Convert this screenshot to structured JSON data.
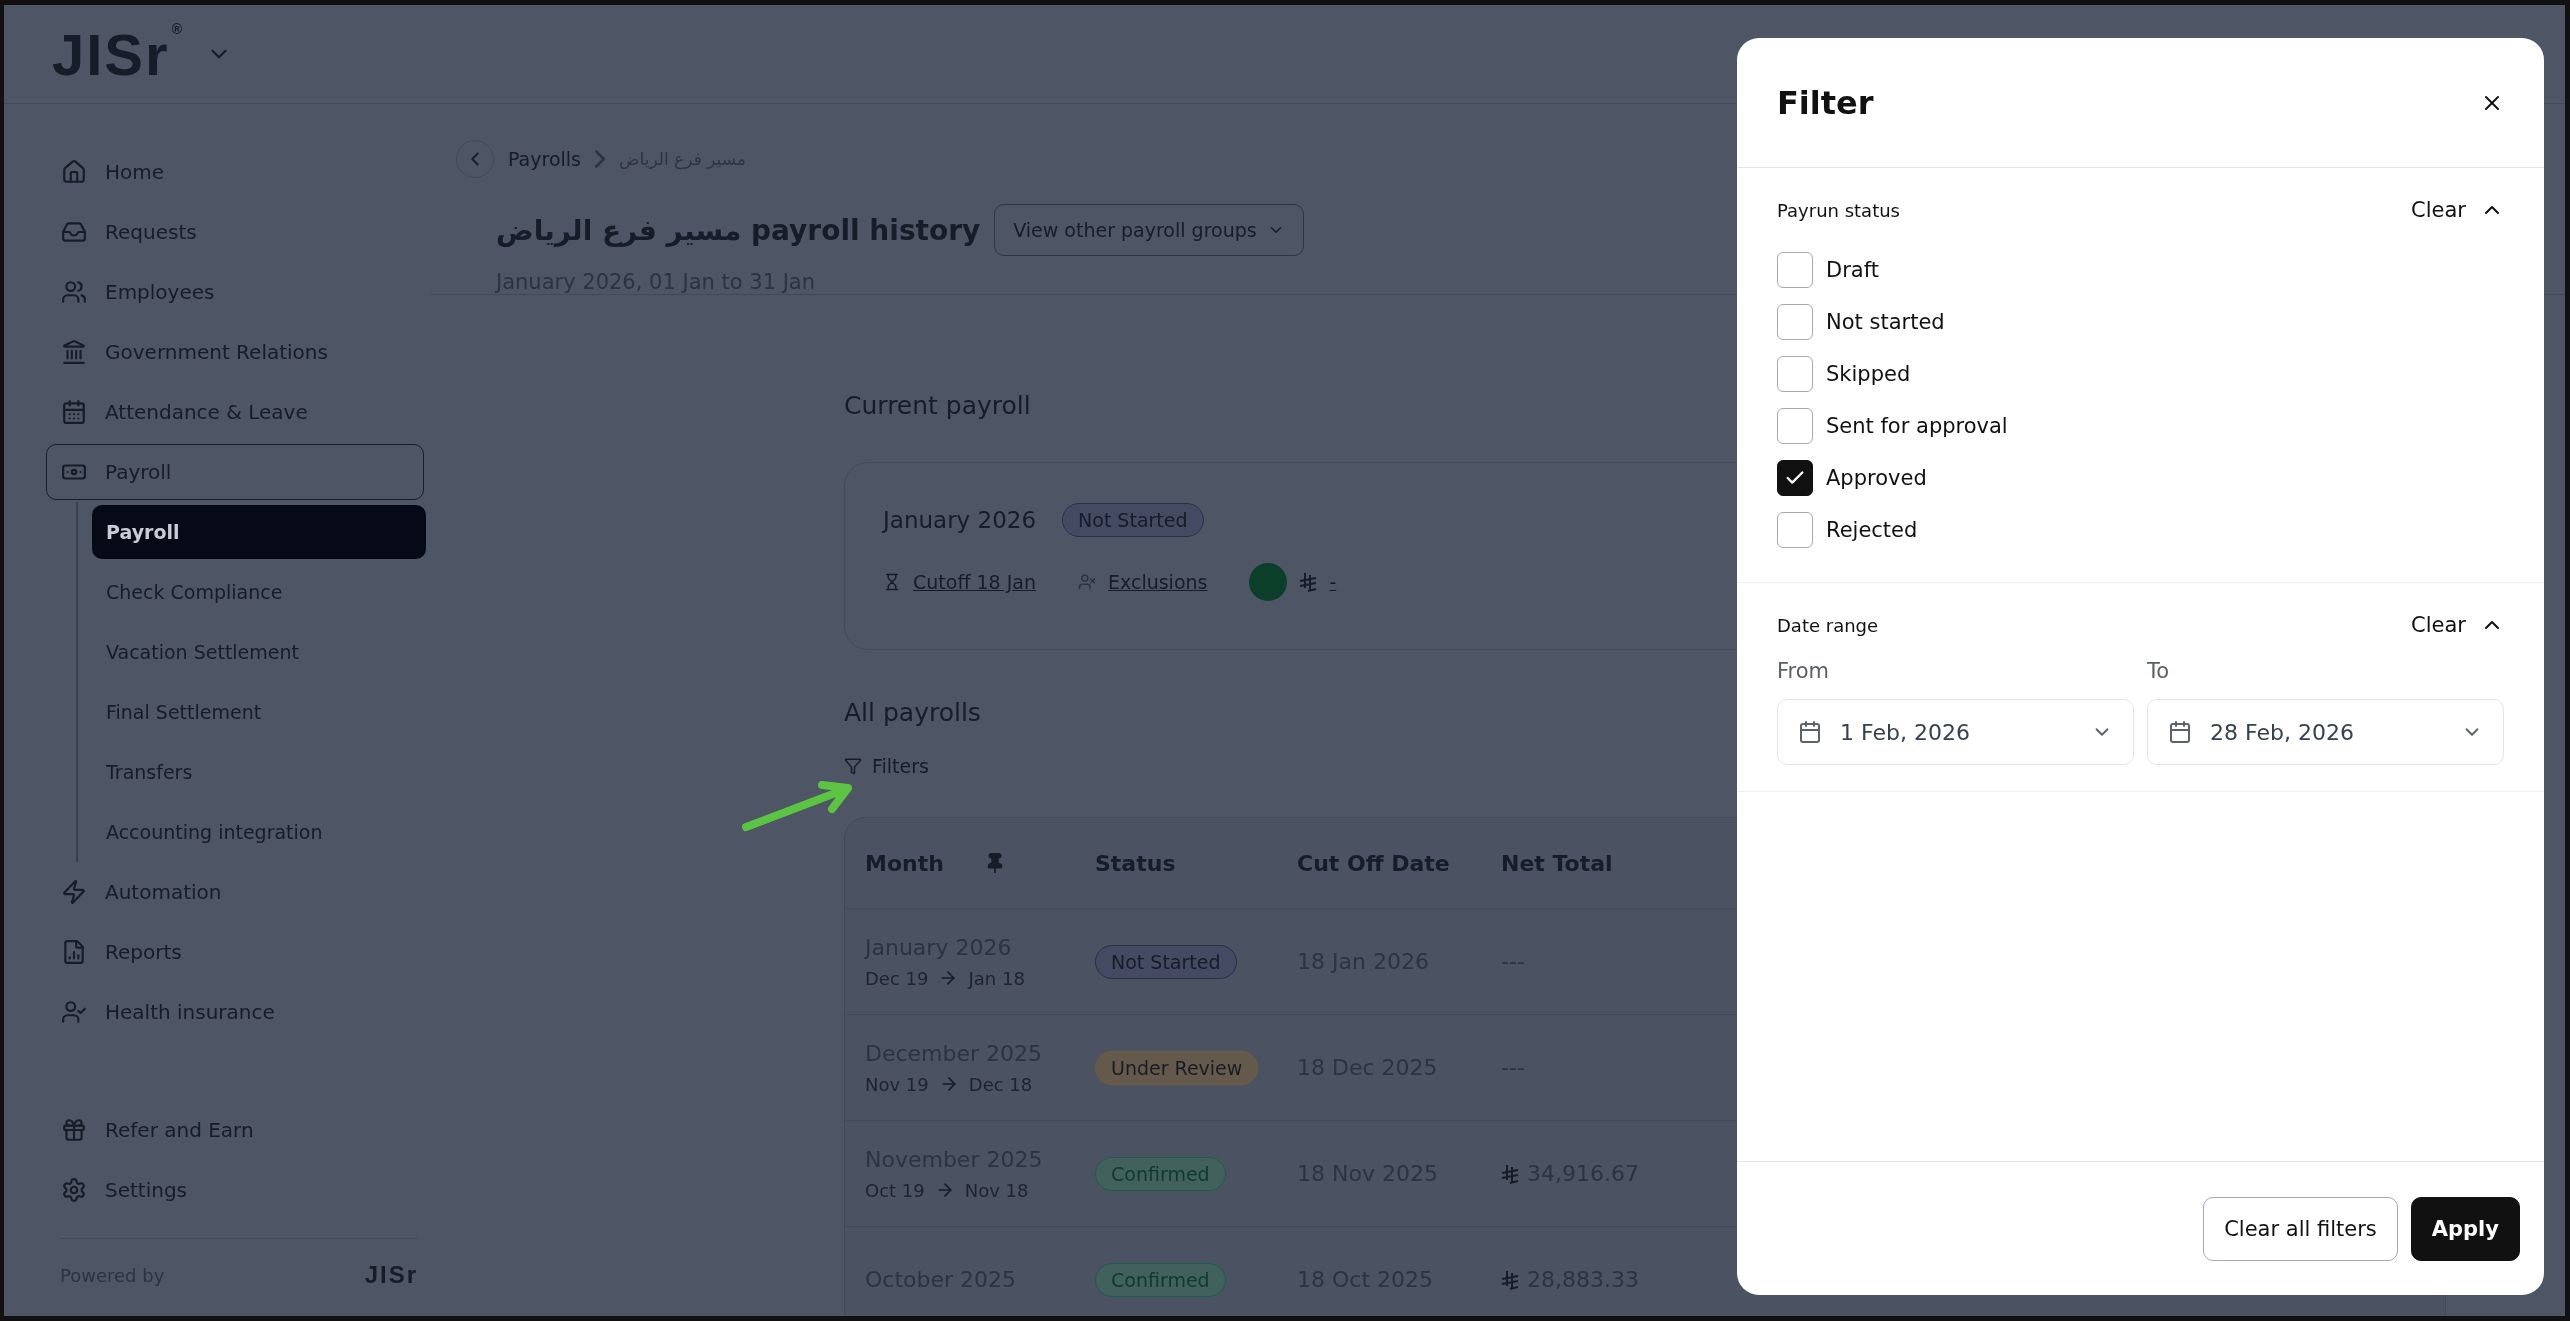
{
  "header": {
    "logo": "JISr",
    "logo_mark": "®"
  },
  "sidebar": {
    "items": [
      {
        "label": "Home",
        "selected": false
      },
      {
        "label": "Requests",
        "selected": false
      },
      {
        "label": "Employees",
        "selected": false
      },
      {
        "label": "Government Relations",
        "selected": false
      },
      {
        "label": "Attendance & Leave",
        "selected": false
      },
      {
        "label": "Payroll",
        "selected": true,
        "expanded": true,
        "children": [
          {
            "label": "Payroll",
            "selected": true
          },
          {
            "label": "Check Compliance",
            "selected": false
          },
          {
            "label": "Vacation Settlement",
            "selected": false
          },
          {
            "label": "Final Settlement",
            "selected": false
          },
          {
            "label": "Transfers",
            "selected": false
          },
          {
            "label": "Accounting integration",
            "selected": false
          }
        ]
      },
      {
        "label": "Automation",
        "selected": false
      },
      {
        "label": "Reports",
        "selected": false
      },
      {
        "label": "Health insurance",
        "selected": false
      }
    ],
    "bottom_items": [
      {
        "label": "Refer and Earn"
      },
      {
        "label": "Settings"
      }
    ],
    "powered_by": "Powered by",
    "powered_logo": "JISr"
  },
  "breadcrumb": [
    "Payrolls",
    "مسير فرع الرياض"
  ],
  "page": {
    "title": "مسير فرع الرياض payroll history",
    "groups_button": "View other payroll groups",
    "subtitle": "January 2026, 01 Jan to 31 Jan"
  },
  "current_payroll": {
    "heading": "Current payroll",
    "month": "January 2026",
    "status": {
      "label": "Not Started",
      "kind": "not_started"
    },
    "cutoff": "Cutoff 18 Jan",
    "exclusions": "Exclusions",
    "amount": "-"
  },
  "all_payrolls": {
    "heading": "All payrolls",
    "filters_button": "Filters",
    "columns": [
      "Month",
      "Status",
      "Cut Off Date",
      "Net Total"
    ],
    "rows": [
      {
        "month": "January 2026",
        "from": "Dec 19",
        "to": "Jan 18",
        "status": {
          "label": "Not Started",
          "kind": "not_started"
        },
        "cutoff": "18 Jan 2026",
        "net_total": "---",
        "currency": false
      },
      {
        "month": "December 2025",
        "from": "Nov 19",
        "to": "Dec 18",
        "status": {
          "label": "Under Review",
          "kind": "review"
        },
        "cutoff": "18 Dec 2025",
        "net_total": "---",
        "currency": false
      },
      {
        "month": "November 2025",
        "from": "Oct 19",
        "to": "Nov 18",
        "status": {
          "label": "Confirmed",
          "kind": "confirmed"
        },
        "cutoff": "18 Nov 2025",
        "net_total": "34,916.67",
        "currency": true
      },
      {
        "month": "October 2025",
        "status": {
          "label": "Confirmed",
          "kind": "confirmed"
        },
        "cutoff": "18 Oct 2025",
        "net_total": "28,883.33",
        "currency": true
      }
    ]
  },
  "filter_panel": {
    "title": "Filter",
    "sections": [
      {
        "kind": "checkboxes",
        "title": "Payrun status",
        "clear": "Clear",
        "expanded": true,
        "options": [
          {
            "label": "Draft",
            "checked": false
          },
          {
            "label": "Not started",
            "checked": false
          },
          {
            "label": "Skipped",
            "checked": false
          },
          {
            "label": "Sent for approval",
            "checked": false
          },
          {
            "label": "Approved",
            "checked": true
          },
          {
            "label": "Rejected",
            "checked": false
          }
        ]
      },
      {
        "kind": "dates",
        "title": "Date range",
        "clear": "Clear",
        "expanded": true,
        "fields": [
          {
            "label": "From",
            "value": "1 Feb, 2026"
          },
          {
            "label": "To",
            "value": "28 Feb, 2026"
          }
        ]
      }
    ],
    "buttons": [
      {
        "label": "Clear all filters",
        "kind": "secondary"
      },
      {
        "label": "Apply",
        "kind": "primary"
      }
    ]
  }
}
